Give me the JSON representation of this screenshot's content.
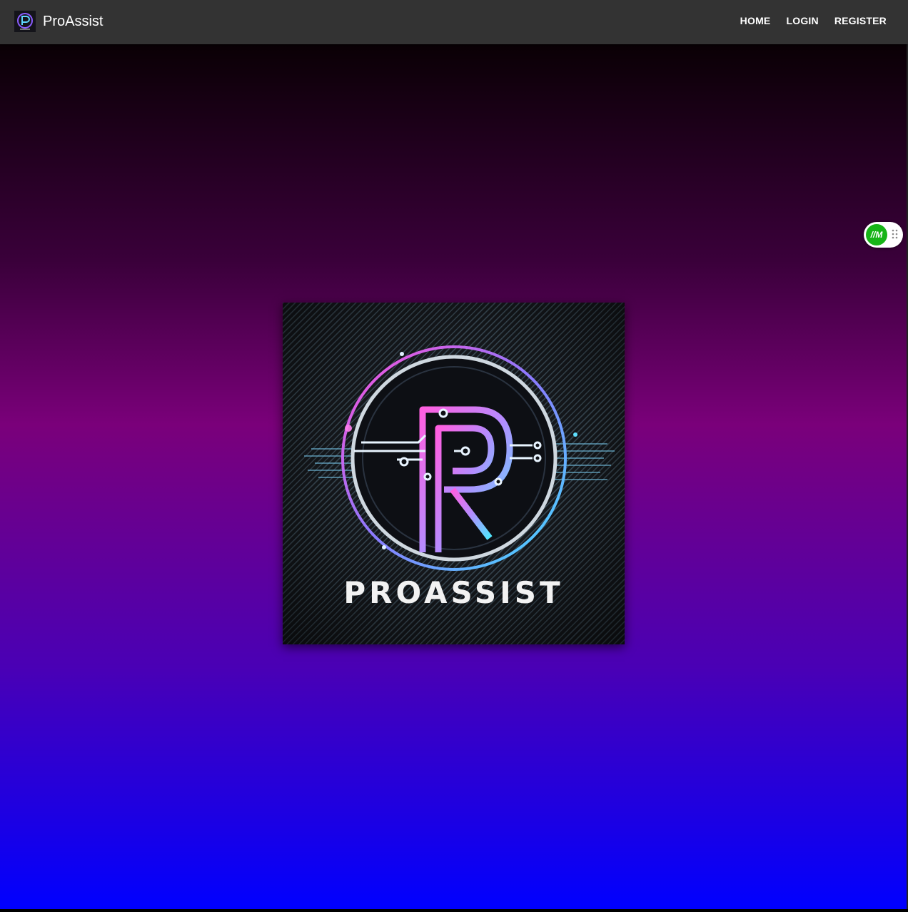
{
  "brand": {
    "name": "ProAssist",
    "logo_icon": "proassist-logo-icon"
  },
  "nav": {
    "home": "HOME",
    "login": "LOGIN",
    "register": "REGISTER"
  },
  "hero": {
    "logo_text": "PROASSIST",
    "logo_icon": "circuit-p-emblem",
    "gradient_colors": [
      "#0a0005",
      "#3a003a",
      "#7a007a",
      "#4a00b5",
      "#0000ff"
    ]
  },
  "widget": {
    "badge": "//M",
    "handle_icon": "drag-handle-icon",
    "badge_color": "#17b417"
  },
  "colors": {
    "navbar": "#333333",
    "nav_text": "#ffffff"
  }
}
